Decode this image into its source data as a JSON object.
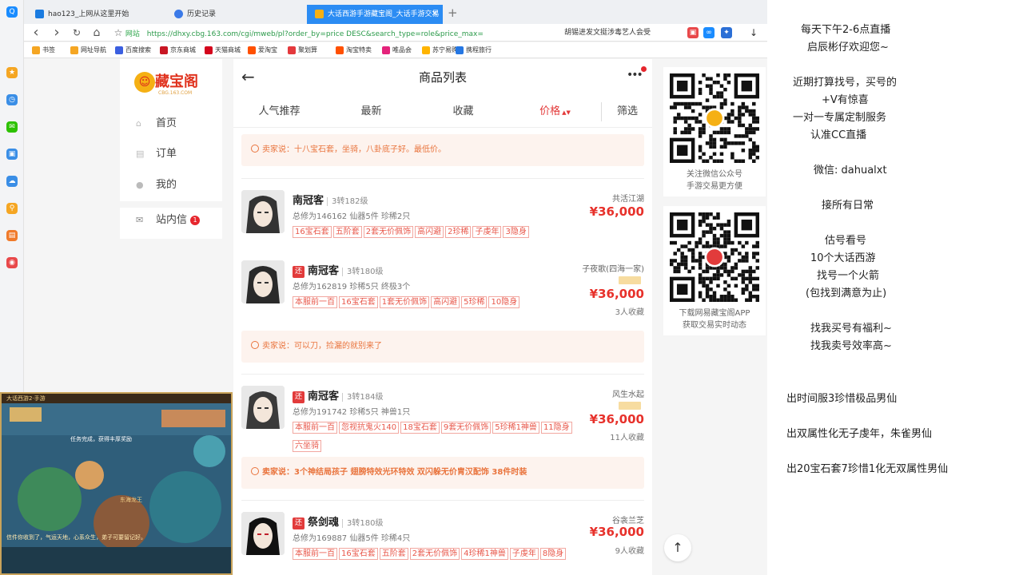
{
  "browser": {
    "tabs": [
      {
        "label": "hao123_上网从这里开始",
        "icon_color": "#1a7be0"
      },
      {
        "label": "历史记录",
        "icon_color": "#3b7ae8"
      },
      {
        "label": "大话西游手游藏宝阁_大话手游交易",
        "icon_color": "#f5b014"
      }
    ],
    "close_glyph": "✕",
    "new_tab_glyph": "+",
    "nav": {
      "back": "‹",
      "forward": "›",
      "refresh": "↻",
      "home": "⌂",
      "star": "☆"
    },
    "url_safe_label": "网站",
    "url": "https://dhxy.cbg.163.com/cgi/mweb/pl?order_by=price DESC&search_type=role&price_max=",
    "search_text": "胡锡进发文挺涉毒艺人会受",
    "bookmarks": [
      {
        "label": "书签",
        "color": "#f5a623"
      },
      {
        "label": "网址导航",
        "color": "#f5a623"
      },
      {
        "label": "百度搜索",
        "color": "#3b5fe0"
      },
      {
        "label": "京东商城",
        "color": "#c81623"
      },
      {
        "label": "天猫商城",
        "color": "#d4041c"
      },
      {
        "label": "爱淘宝",
        "color": "#ff5000"
      },
      {
        "label": "聚划算",
        "color": "#e4393c"
      },
      {
        "label": "淘宝特卖",
        "color": "#ff5000"
      },
      {
        "label": "唯品会",
        "color": "#e4237b"
      },
      {
        "label": "苏宁易购",
        "color": "#ffb400"
      },
      {
        "label": "携程旅行",
        "color": "#2577e3"
      }
    ]
  },
  "site_sidebar": {
    "logo_text": "藏宝阁",
    "logo_sub": "CBG.163.COM",
    "items": [
      {
        "label": "首页",
        "icon": "home-icon",
        "glyph": "⌂"
      },
      {
        "label": "订单",
        "icon": "order-icon",
        "glyph": "▤"
      },
      {
        "label": "我的",
        "icon": "user-icon",
        "glyph": "●"
      }
    ],
    "inbox_label": "站内信",
    "inbox_count": "1"
  },
  "main": {
    "back_glyph": "←",
    "title": "商品列表",
    "more_glyph": "•••",
    "sort_tabs": [
      "人气推荐",
      "最新",
      "收藏",
      "价格",
      "筛选"
    ],
    "sort_arrow": "▲▼",
    "notices": [
      "卖家说：十八宝石套，坐骑，八卦底子好。最低价。",
      "卖家说：可以刀，捡漏的就别来了",
      "卖家说：3个神结局孩子 翅膀特效光环特效 双闪躲无价胄汉配饰 38件时装"
    ],
    "items": [
      {
        "returning": false,
        "name": "南冠客",
        "level": "3转182级",
        "sub": "总修为146162  仙器5件  珍稀2只",
        "tags": [
          "16宝石套",
          "五阶套",
          "2套无价佩饰",
          "高闪避",
          "2珍稀",
          "子虔年",
          "3隐身"
        ],
        "server": "共活江湖",
        "price": "¥36,000",
        "fav": ""
      },
      {
        "returning": true,
        "name": "南冠客",
        "level": "3转180级",
        "sub": "总修为162819  珍稀5只  终极3个",
        "tags": [
          "本服前一百",
          "16宝石套",
          "1套无价佩饰",
          "高闪避",
          "5珍稀",
          "10隐身"
        ],
        "server": "子夜歌(四海一家)",
        "price": "¥36,000",
        "fav": "3人收藏"
      },
      {
        "returning": true,
        "name": "南冠客",
        "level": "3转184级",
        "sub": "总修为191742  珍稀5只  神兽1只",
        "tags": [
          "本服前一百",
          "忽视抗鬼火140",
          "18宝石套",
          "9套无价佩饰",
          "5珍稀1神兽",
          "11隐身",
          "六坐骑"
        ],
        "server": "风生水起",
        "price": "¥36,000",
        "fav": "11人收藏"
      },
      {
        "returning": true,
        "name": "祭剑魂",
        "level": "3转180级",
        "sub": "总修为169887  仙器5件  珍稀4只",
        "tags": [
          "本服前一百",
          "16宝石套",
          "五阶套",
          "2套无价佩饰",
          "4珍稀1神兽",
          "子虔年",
          "8隐身"
        ],
        "server": "谷衾兰芝",
        "price": "¥36,000",
        "fav": "9人收藏"
      }
    ],
    "returning_label": "还"
  },
  "qr": {
    "card1": [
      "关注微信公众号",
      "手游交易更方便"
    ],
    "card2": [
      "下载网易藏宝阁APP",
      "获取交易实时动态"
    ],
    "to_top_glyph": "↑"
  },
  "overlay": {
    "lines": [
      "每天下午2-6点直播",
      "启辰彬仔欢迎您~",
      "近期打算找号，买号的",
      "+V有惊喜",
      "一对一专属定制服务",
      "认准CC直播",
      "微信:    dahualxt",
      "接所有日常",
      "估号看号",
      "10个大话西游",
      "找号一个火箭",
      "(包找到满意为止)",
      "找我买号有福利~",
      "找我卖号效率高~",
      "出时间服3珍惜极品男仙",
      "出双属性化无子虔年，朱雀男仙",
      "出20宝石套7珍惜1化无双属性男仙"
    ]
  },
  "game": {
    "title": "大话西游2·手游",
    "texts": [
      "任务完成，获得丰厚奖励",
      "东海龙王",
      "信件你收到了，气运天地，心系众生，弟子可要留记好。"
    ]
  }
}
